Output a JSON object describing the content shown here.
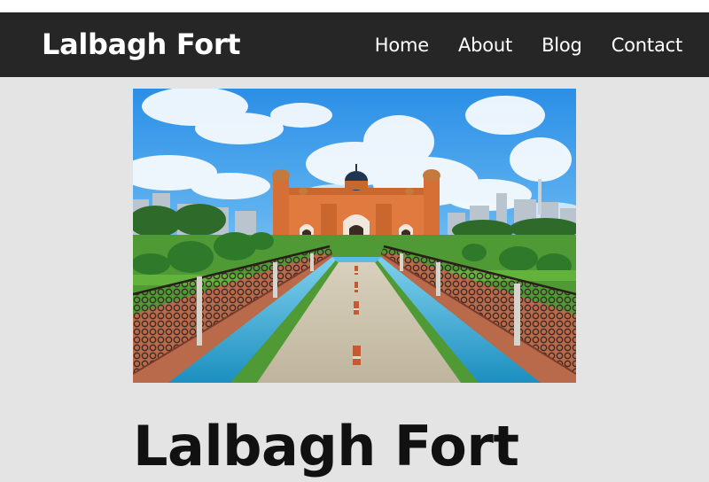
{
  "site": {
    "brand": "Lalbagh Fort"
  },
  "nav": {
    "items": [
      {
        "label": "Home"
      },
      {
        "label": "About"
      },
      {
        "label": "Blog"
      },
      {
        "label": "Contact"
      }
    ]
  },
  "hero": {
    "alt": "Lalbagh Fort"
  },
  "article": {
    "title": "Lalbagh Fort"
  },
  "colors": {
    "navbar_bg": "#262626",
    "page_bg": "#e4e4e4",
    "nav_text": "#ffffff",
    "headline_text": "#111111"
  }
}
